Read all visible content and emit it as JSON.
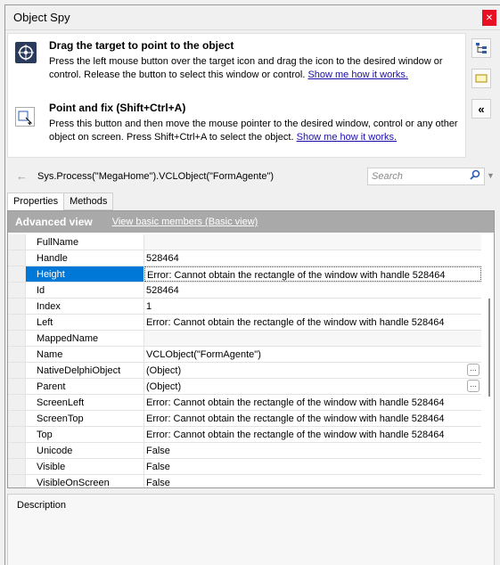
{
  "window": {
    "title": "Object Spy"
  },
  "drag_section": {
    "title": "Drag the target to point to the object",
    "text": "Press the left mouse button over the target icon and drag the icon to the desired window or control. Release the button to select this window or control.",
    "link": "Show me how it works."
  },
  "point_section": {
    "title": "Point and fix (Shift+Ctrl+A)",
    "text": "Press this button and then move the mouse pointer to the desired window, control or any other object on screen. Press Shift+Ctrl+A to select the object.",
    "link": "Show me how it works."
  },
  "path": {
    "text": "Sys.Process(\"MegaHome\").VCLObject(\"FormAgente\")"
  },
  "search": {
    "placeholder": "Search"
  },
  "tabs": [
    {
      "label": "Properties"
    },
    {
      "label": "Methods"
    }
  ],
  "grid": {
    "header": "Advanced view",
    "basic_link": "View basic members (Basic view)",
    "rows": [
      {
        "name": "FullName",
        "value": ""
      },
      {
        "name": "Handle",
        "value": "528464"
      },
      {
        "name": "Height",
        "value": "Error: Cannot obtain the rectangle of the window with handle 528464"
      },
      {
        "name": "Id",
        "value": "528464"
      },
      {
        "name": "Index",
        "value": "1"
      },
      {
        "name": "Left",
        "value": "Error: Cannot obtain the rectangle of the window with handle 528464"
      },
      {
        "name": "MappedName",
        "value": ""
      },
      {
        "name": "Name",
        "value": "VCLObject(\"FormAgente\")"
      },
      {
        "name": "NativeDelphiObject",
        "value": "(Object)"
      },
      {
        "name": "Parent",
        "value": "(Object)"
      },
      {
        "name": "ScreenLeft",
        "value": "Error: Cannot obtain the rectangle of the window with handle 528464"
      },
      {
        "name": "ScreenTop",
        "value": "Error: Cannot obtain the rectangle of the window with handle 528464"
      },
      {
        "name": "Top",
        "value": "Error: Cannot obtain the rectangle of the window with handle 528464"
      },
      {
        "name": "Unicode",
        "value": "False"
      },
      {
        "name": "Visible",
        "value": "False"
      },
      {
        "name": "VisibleOnScreen",
        "value": "False"
      }
    ]
  },
  "description": {
    "label": "Description"
  }
}
